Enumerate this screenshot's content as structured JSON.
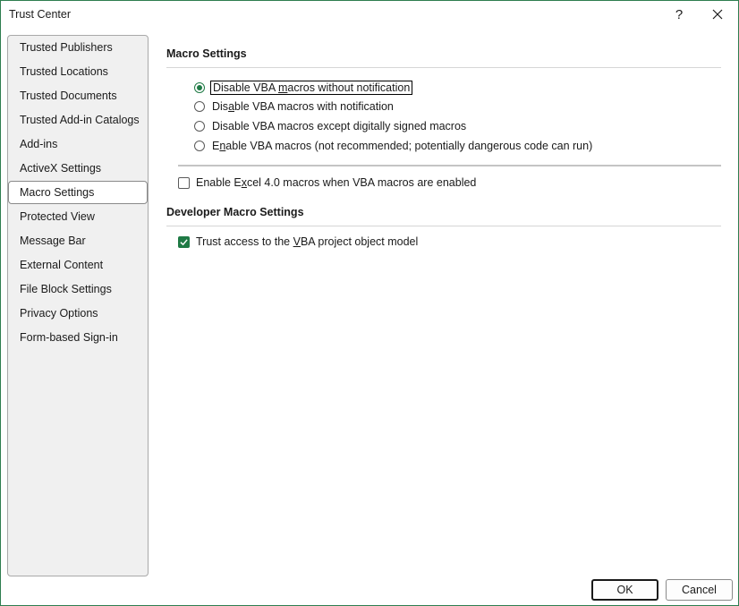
{
  "window": {
    "title": "Trust Center",
    "help_label": "?",
    "close_icon": "close-icon"
  },
  "sidebar": {
    "items": [
      {
        "label": "Trusted Publishers"
      },
      {
        "label": "Trusted Locations"
      },
      {
        "label": "Trusted Documents"
      },
      {
        "label": "Trusted Add-in Catalogs"
      },
      {
        "label": "Add-ins"
      },
      {
        "label": "ActiveX Settings"
      },
      {
        "label": "Macro Settings",
        "selected": true
      },
      {
        "label": "Protected View"
      },
      {
        "label": "Message Bar"
      },
      {
        "label": "External Content"
      },
      {
        "label": "File Block Settings"
      },
      {
        "label": "Privacy Options"
      },
      {
        "label": "Form-based Sign-in"
      }
    ]
  },
  "macro_settings": {
    "title": "Macro Settings",
    "options": [
      {
        "pre": "Disable VBA ",
        "key": "m",
        "post": "acros without notification",
        "checked": true
      },
      {
        "pre": "Dis",
        "key": "a",
        "post": "ble VBA macros with notification",
        "checked": false
      },
      {
        "pre": "Disable VBA macros except di",
        "key": "g",
        "post": "itally signed macros",
        "checked": false
      },
      {
        "pre": "E",
        "key": "n",
        "post": "able VBA macros (not recommended; potentially dangerous code can run)",
        "checked": false
      }
    ],
    "excel4": {
      "pre": "Enable E",
      "key": "x",
      "post": "cel 4.0 macros when VBA macros are enabled",
      "checked": false
    }
  },
  "developer_settings": {
    "title": "Developer Macro Settings",
    "trust_vba": {
      "pre": "Trust access to the ",
      "key": "V",
      "post": "BA project object model",
      "checked": true
    }
  },
  "footer": {
    "ok_label": "OK",
    "cancel_label": "Cancel"
  },
  "colors": {
    "accent": "#1f7a45",
    "sidebar_bg": "#f0f0f0"
  }
}
